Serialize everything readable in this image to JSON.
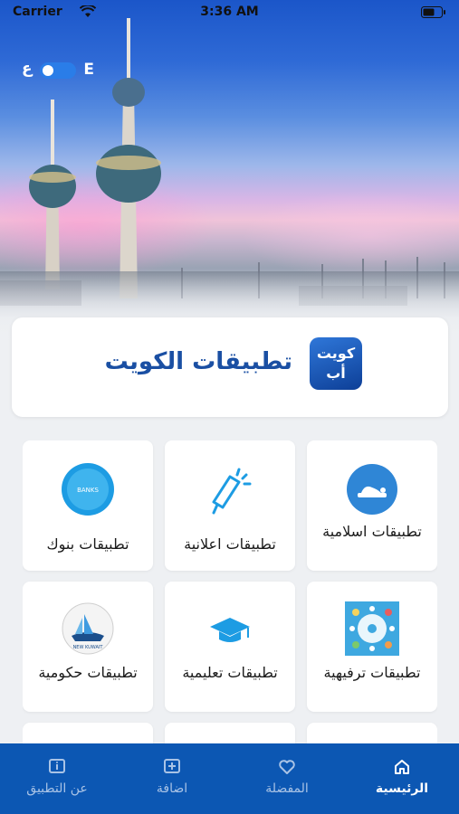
{
  "status_bar": {
    "carrier": "Carrier",
    "time": "3:36 AM"
  },
  "language_toggle": {
    "arabic": "ع",
    "english": "E"
  },
  "header": {
    "logo_line1": "كويت",
    "logo_line2": "أب",
    "title": "تطبيقات الكويت"
  },
  "categories": [
    {
      "label": "تطبيقات بنوك",
      "icon": "banks-icon",
      "icon_text": "BANKS"
    },
    {
      "label": "تطبيقات اعلانية",
      "icon": "megaphone-icon"
    },
    {
      "label": "تطبيقات اسلامية",
      "icon": "prayer-icon"
    },
    {
      "label": "تطبيقات حكومية",
      "icon": "new-kuwait-icon",
      "icon_text": "NEW KUWAIT"
    },
    {
      "label": "تطبيقات تعليمية",
      "icon": "graduation-cap-icon"
    },
    {
      "label": "تطبيقات ترفيهية",
      "icon": "entertainment-icon"
    }
  ],
  "tab_bar": {
    "about": "عن التطبيق",
    "add": "اضافة",
    "favorites": "المفضلة",
    "home": "الرئيسية"
  },
  "colors": {
    "primary": "#0c57b3",
    "title_blue": "#1a4fa3",
    "accent": "#2a7de8"
  }
}
